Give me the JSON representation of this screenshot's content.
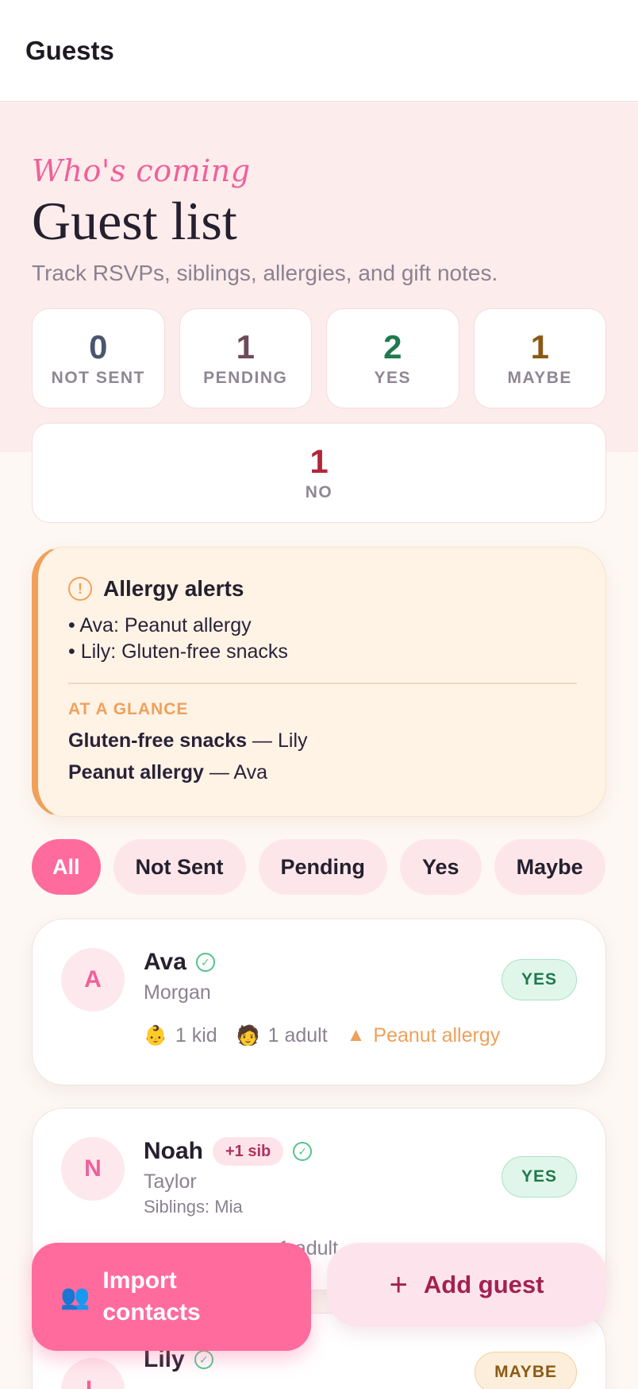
{
  "topbar": {
    "title": "Guests"
  },
  "header": {
    "kicker": "Who's coming",
    "title": "Guest list",
    "subtitle": "Track RSVPs, siblings, allergies, and gift notes."
  },
  "stats": [
    {
      "value": "0",
      "label": "NOT SENT",
      "color": "#4a5670"
    },
    {
      "value": "1",
      "label": "PENDING",
      "color": "#6d4a5c"
    },
    {
      "value": "2",
      "label": "YES",
      "color": "#1f7a4d"
    },
    {
      "value": "1",
      "label": "MAYBE",
      "color": "#8a5a14"
    },
    {
      "value": "1",
      "label": "NO",
      "color": "#b0283c"
    }
  ],
  "allergy": {
    "title": "Allergy alerts",
    "items": [
      "• Ava: Peanut allergy",
      "• Lily: Gluten-free snacks"
    ],
    "glance_label": "AT A GLANCE",
    "glance": [
      {
        "item": "Gluten-free snacks",
        "who": " — Lily"
      },
      {
        "item": "Peanut allergy",
        "who": " — Ava"
      }
    ]
  },
  "filters": [
    "All",
    "Not Sent",
    "Pending",
    "Yes",
    "Maybe"
  ],
  "guests": [
    {
      "initial": "A",
      "first": "Ava",
      "last": "Morgan",
      "status": "YES",
      "kids": "1 kid",
      "adults": "1 adult",
      "allergy": "Peanut allergy"
    },
    {
      "initial": "N",
      "first": "Noah",
      "last": "Taylor",
      "sib_badge": "+1 sib",
      "siblings": "Siblings: Mia",
      "status": "YES",
      "adults": "1 adult"
    },
    {
      "initial": "L",
      "first": "Lily",
      "status": "MAYBE"
    }
  ],
  "actions": {
    "import": "Import contacts",
    "add": "Add guest"
  },
  "icons": {
    "check": "check-circle-icon",
    "alert": "alert-circle-icon",
    "warning": "warning-icon",
    "people": "people-icon",
    "plus": "plus-icon"
  }
}
